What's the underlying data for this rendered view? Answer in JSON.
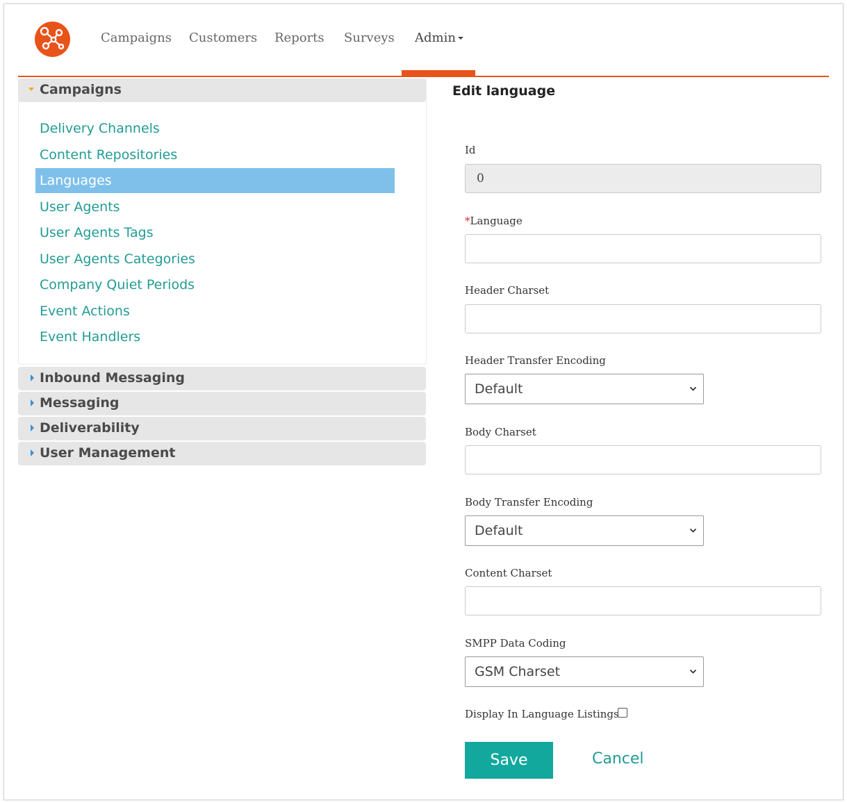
{
  "nav": {
    "items": [
      "Campaigns",
      "Customers",
      "Reports",
      "Surveys",
      "Admin"
    ],
    "active": "Admin",
    "accent_color": "#e8531a"
  },
  "sidebar": {
    "campaigns": {
      "title": "Campaigns",
      "links": [
        "Delivery Channels",
        "Content Repositories",
        "Languages",
        "User Agents",
        "User Agents Tags",
        "User Agents Categories",
        "Company Quiet Periods",
        "Event Actions",
        "Event Handlers"
      ],
      "active_link": "Languages"
    },
    "collapsed": [
      "Inbound Messaging",
      "Messaging",
      "Deliverability",
      "User Management"
    ]
  },
  "form": {
    "title": "Edit language",
    "id": {
      "label": "Id",
      "value": "0"
    },
    "language": {
      "required_mark": "*",
      "label": "Language",
      "value": ""
    },
    "header_charset": {
      "label": "Header Charset",
      "value": ""
    },
    "header_transfer_encoding": {
      "label": "Header Transfer Encoding",
      "selected": "Default"
    },
    "body_charset": {
      "label": "Body Charset",
      "value": ""
    },
    "body_transfer_encoding": {
      "label": "Body Transfer Encoding",
      "selected": "Default"
    },
    "content_charset": {
      "label": "Content Charset",
      "value": ""
    },
    "smpp_data_coding": {
      "label": "SMPP Data Coding",
      "selected": "GSM Charset"
    },
    "display_in_listings": {
      "label": "Display In Language Listings",
      "checked": false
    },
    "save_label": "Save",
    "cancel_label": "Cancel"
  }
}
